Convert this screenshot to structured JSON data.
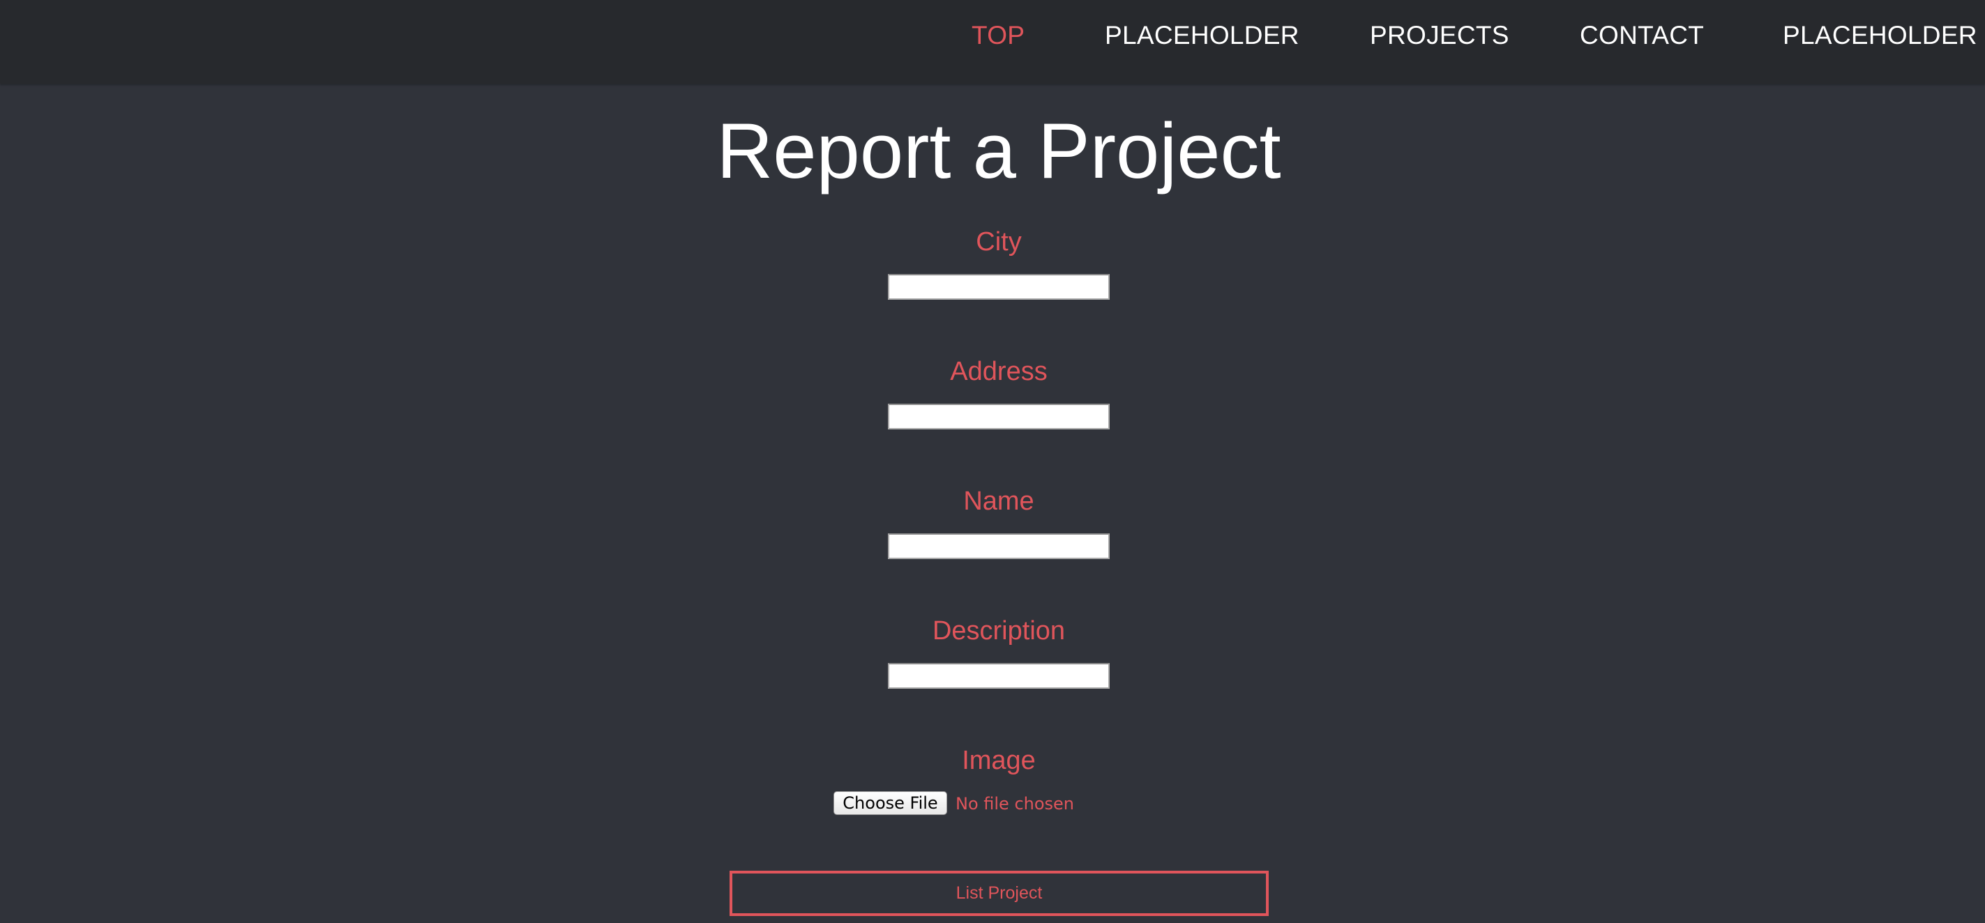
{
  "nav": {
    "items": [
      {
        "label": "TOP",
        "active": true
      },
      {
        "label": "PLACEHOLDER",
        "active": false
      },
      {
        "label": "PROJECTS",
        "active": false
      },
      {
        "label": "CONTACT",
        "active": false
      },
      {
        "label": "PLACEHOLDER",
        "active": false
      }
    ]
  },
  "form": {
    "title": "Report a Project",
    "fields": [
      {
        "label": "City",
        "value": ""
      },
      {
        "label": "Address",
        "value": ""
      },
      {
        "label": "Name",
        "value": ""
      },
      {
        "label": "Description",
        "value": ""
      }
    ],
    "image": {
      "label": "Image",
      "button_label": "Choose File",
      "status": "No file chosen"
    },
    "submit_label": "List Project"
  },
  "colors": {
    "background": "#30333a",
    "navbar": "#27292d",
    "accent": "#e0555b",
    "text": "#ffffff"
  }
}
